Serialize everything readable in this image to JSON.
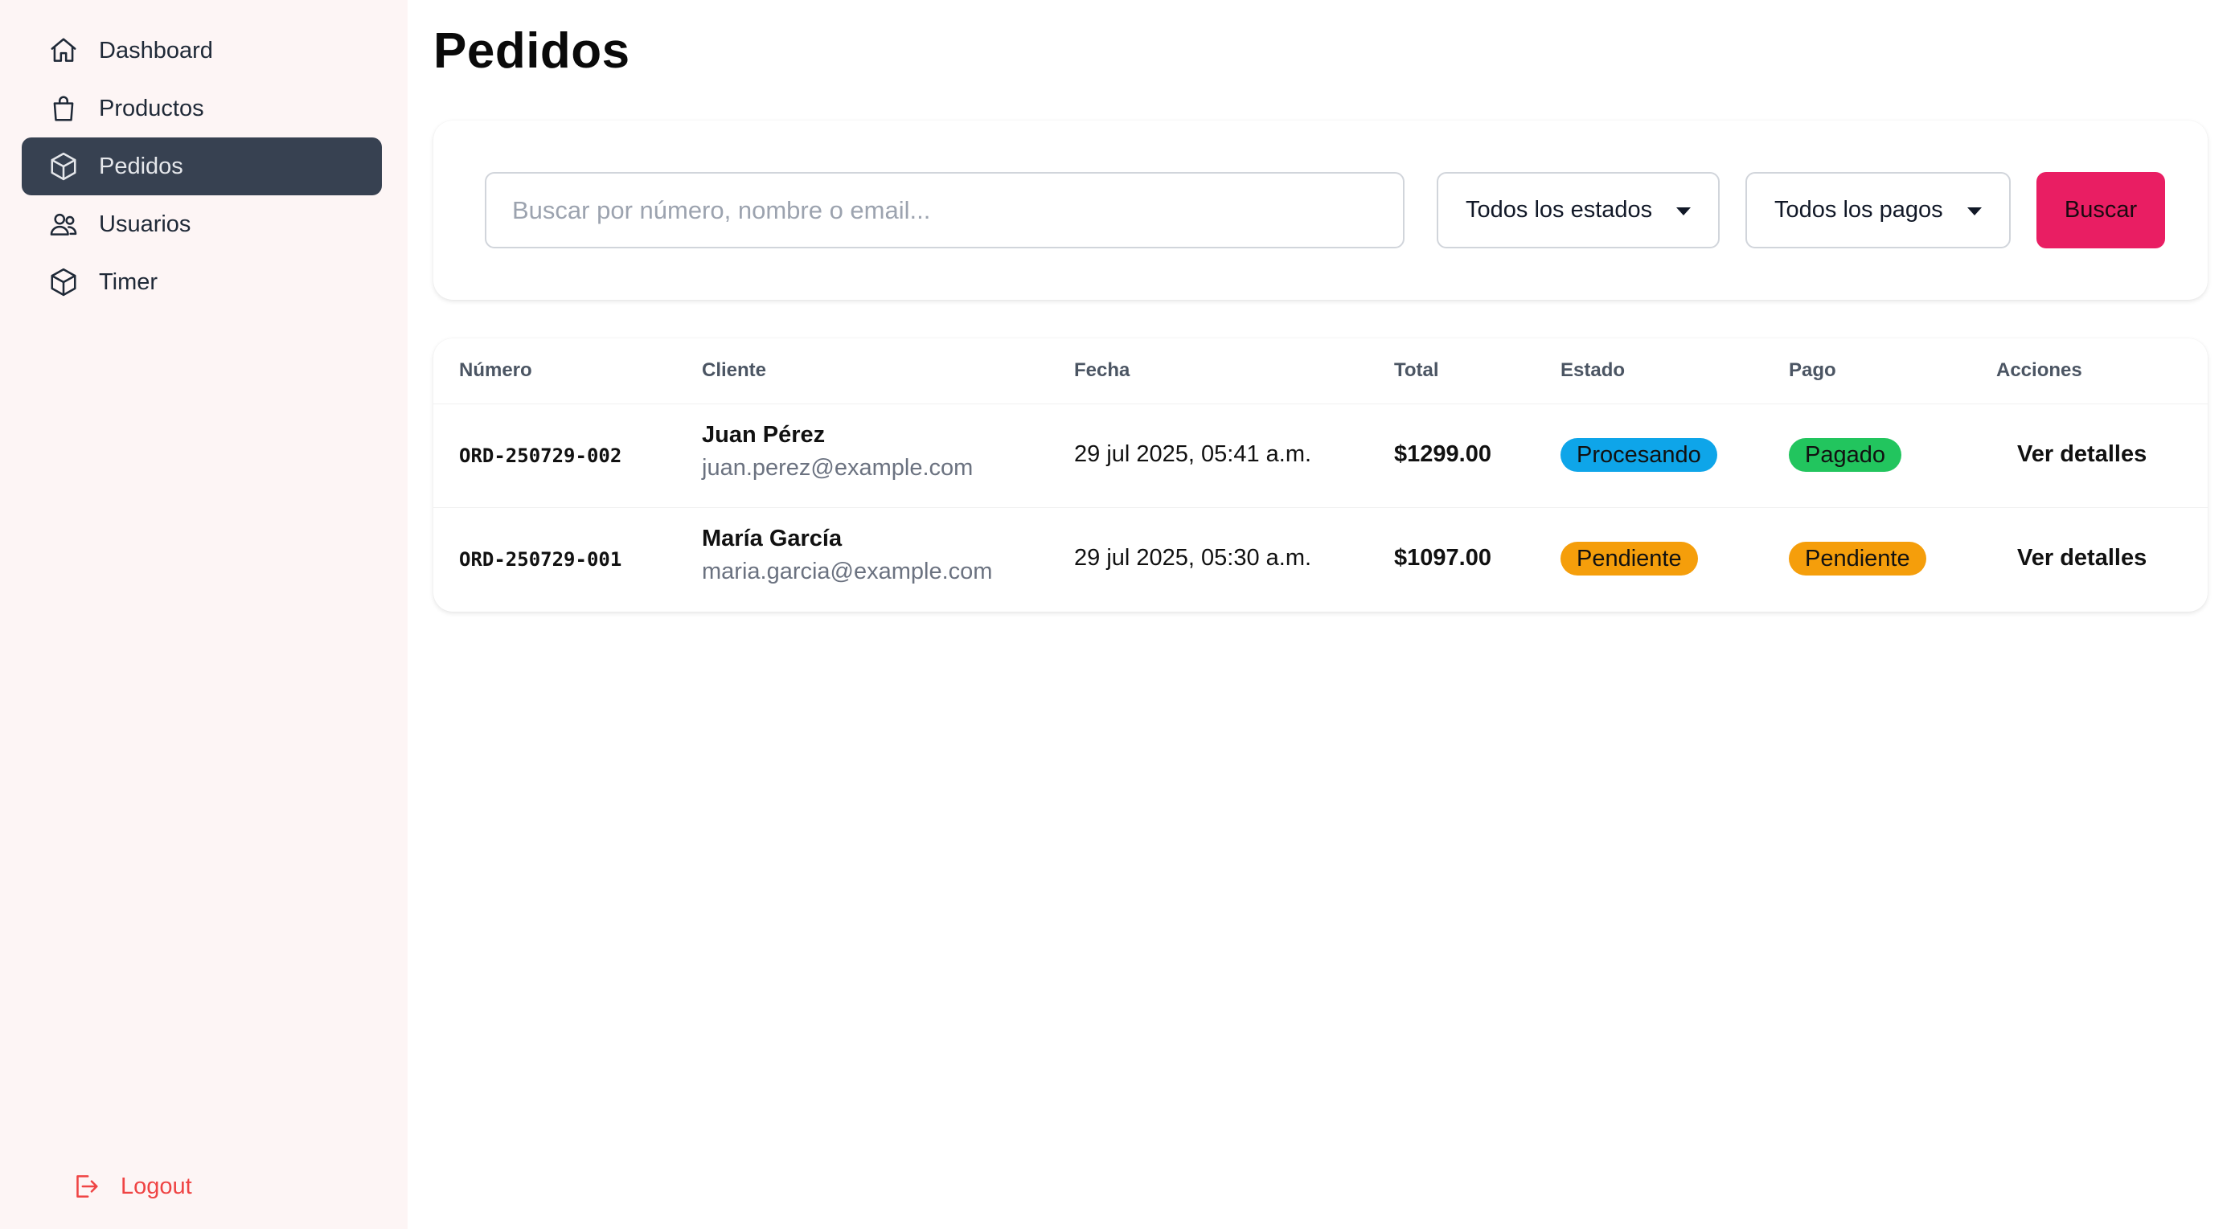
{
  "sidebar": {
    "items": [
      {
        "label": "Dashboard",
        "icon": "home-icon"
      },
      {
        "label": "Productos",
        "icon": "shopping-bag-icon"
      },
      {
        "label": "Pedidos",
        "icon": "box-icon",
        "active": true
      },
      {
        "label": "Usuarios",
        "icon": "users-icon"
      },
      {
        "label": "Timer",
        "icon": "box-icon"
      }
    ],
    "logout_label": "Logout"
  },
  "main": {
    "title": "Pedidos",
    "filters": {
      "search_placeholder": "Buscar por número, nombre o email...",
      "status_selected": "Todos los estados",
      "payment_selected": "Todos los pagos",
      "search_button": "Buscar"
    },
    "table": {
      "headers": [
        "Número",
        "Cliente",
        "Fecha",
        "Total",
        "Estado",
        "Pago",
        "Acciones"
      ],
      "rows": [
        {
          "number": "ORD-250729-002",
          "customer_name": "Juan Pérez",
          "customer_email": "juan.perez@example.com",
          "date": "29 jul 2025, 05:41 a.m.",
          "total": "$1299.00",
          "status": "Procesando",
          "payment": "Pagado",
          "action": "Ver detalles"
        },
        {
          "number": "ORD-250729-001",
          "customer_name": "María García",
          "customer_email": "maria.garcia@example.com",
          "date": "29 jul 2025, 05:30 a.m.",
          "total": "$1097.00",
          "status": "Pendiente",
          "payment": "Pendiente",
          "action": "Ver detalles"
        }
      ]
    }
  },
  "colors": {
    "sidebar_bg": "#fdf5f5",
    "active_nav_bg": "#374151",
    "accent": "#e91e63",
    "logout": "#ef4444",
    "status_processing": "#0ea5e9",
    "status_paid": "#22c55e",
    "status_pending": "#f59e0b"
  }
}
